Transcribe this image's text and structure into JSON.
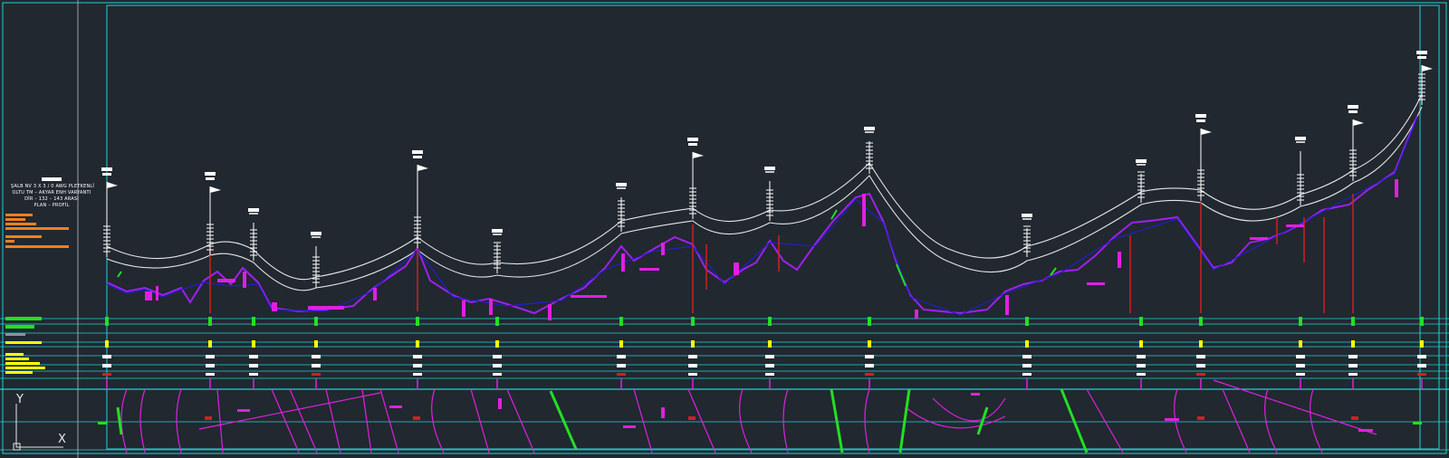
{
  "title_block": {
    "lines": [
      "ŞALB NV 3 X 3 / 0 AWG PLETKENLİ",
      "OLTU TM – AKYAR ENH VARYANTI",
      "DİR – 132 – 143 ARASI",
      "PLAN – PROFİL"
    ]
  },
  "ucs": {
    "y_label": "Y",
    "x_label": "X"
  },
  "colors": {
    "background": "#212830",
    "frame": "#1fd3d3",
    "conductor": "#e6e6e6",
    "ground_profile": "#a020f0",
    "ground_profile_secondary": "#2020c8",
    "tower": "#ffffff",
    "magenta": "#e020e0",
    "green": "#22e022",
    "yellow": "#ffff00",
    "red": "#d02020",
    "orange": "#f08020"
  },
  "towers": [
    {
      "id": "T1",
      "type": "flag"
    },
    {
      "id": "T2",
      "type": "flag"
    },
    {
      "id": "T3",
      "type": "cross"
    },
    {
      "id": "T4",
      "type": "cross"
    },
    {
      "id": "T5",
      "type": "flag"
    },
    {
      "id": "T6",
      "type": "cross"
    },
    {
      "id": "T7",
      "type": "cross"
    },
    {
      "id": "T8",
      "type": "flag"
    },
    {
      "id": "T9",
      "type": "cross"
    },
    {
      "id": "T10",
      "type": "cross"
    },
    {
      "id": "T11",
      "type": "cross"
    },
    {
      "id": "T12",
      "type": "cross"
    },
    {
      "id": "T13",
      "type": "flag"
    },
    {
      "id": "T14",
      "type": "cross"
    },
    {
      "id": "T15",
      "type": "flag"
    },
    {
      "id": "T16",
      "type": "flag"
    }
  ]
}
